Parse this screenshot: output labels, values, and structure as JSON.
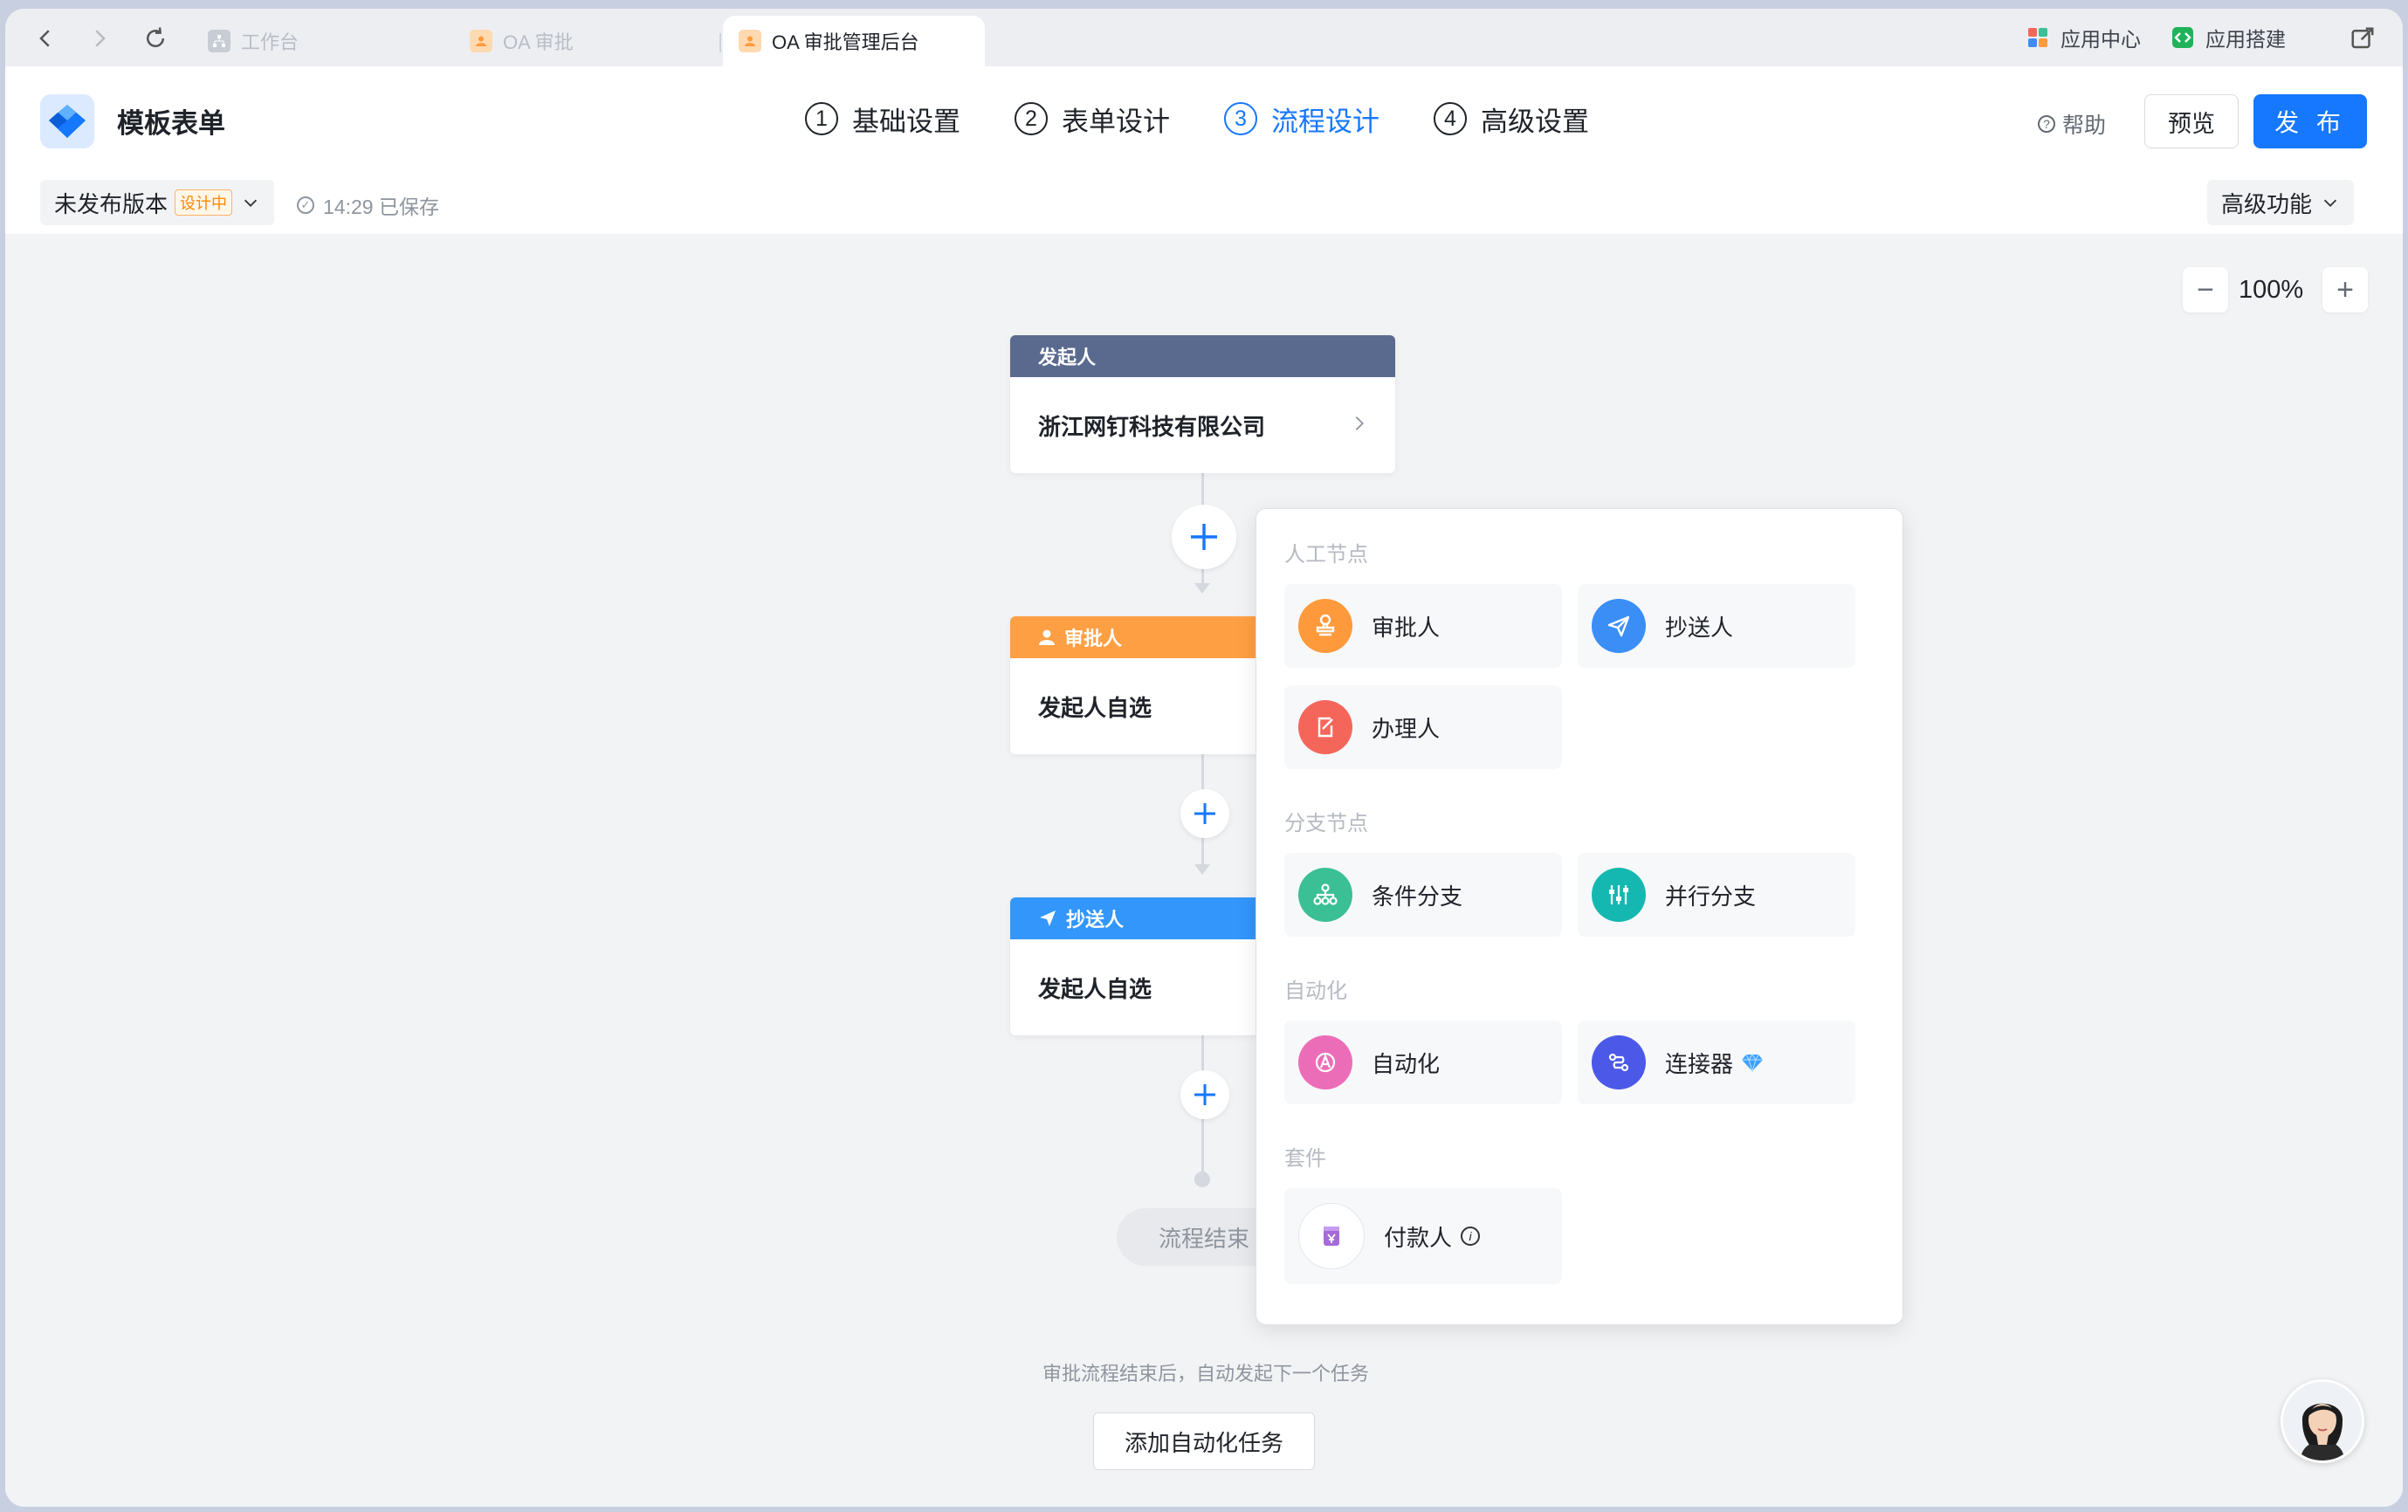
{
  "tabs": [
    {
      "label": "工作台"
    },
    {
      "label": "OA 审批"
    },
    {
      "label": "OA 审批管理后台"
    }
  ],
  "topright": {
    "app_center": "应用中心",
    "app_build": "应用搭建"
  },
  "header": {
    "title": "模板表单",
    "steps": [
      {
        "num": "1",
        "label": "基础设置"
      },
      {
        "num": "2",
        "label": "表单设计"
      },
      {
        "num": "3",
        "label": "流程设计"
      },
      {
        "num": "4",
        "label": "高级设置"
      }
    ],
    "help": "帮助",
    "preview": "预览",
    "publish": "发 布"
  },
  "subbar": {
    "version": "未发布版本",
    "version_badge": "设计中",
    "saved": "14:29 已保存",
    "advanced": "高级功能"
  },
  "canvas": {
    "zoom": "100%",
    "nodes": [
      {
        "header": "发起人",
        "body": "浙江网钉科技有限公司",
        "color": "#5a6a8f"
      },
      {
        "header": "审批人",
        "body": "发起人自选",
        "color": "#ff9f43"
      },
      {
        "header": "抄送人",
        "body": "发起人自选",
        "color": "#3296fa"
      }
    ],
    "end_label": "流程结束",
    "hint": "审批流程结束后，自动发起下一个任务",
    "auto_button": "添加自动化任务"
  },
  "popup": {
    "sections": [
      {
        "title": "人工节点",
        "items": [
          {
            "label": "审批人",
            "icon": "stamp-icon",
            "color": "#ff9a3c"
          },
          {
            "label": "抄送人",
            "icon": "send-icon",
            "color": "#3a8ef6"
          },
          {
            "label": "办理人",
            "icon": "edit-doc-icon",
            "color": "#f5665a"
          }
        ]
      },
      {
        "title": "分支节点",
        "items": [
          {
            "label": "条件分支",
            "icon": "branch-icon",
            "color": "#3bbf94"
          },
          {
            "label": "并行分支",
            "icon": "parallel-icon",
            "color": "#14b8b0"
          }
        ]
      },
      {
        "title": "自动化",
        "items": [
          {
            "label": "自动化",
            "icon": "automation-icon",
            "color": "#ec6db7"
          },
          {
            "label": "连接器",
            "icon": "connector-icon",
            "color": "#4c59e8"
          }
        ]
      },
      {
        "title": "套件",
        "items": [
          {
            "label": "付款人",
            "icon": "payment-icon",
            "color": "#a66bd9"
          }
        ]
      }
    ]
  }
}
